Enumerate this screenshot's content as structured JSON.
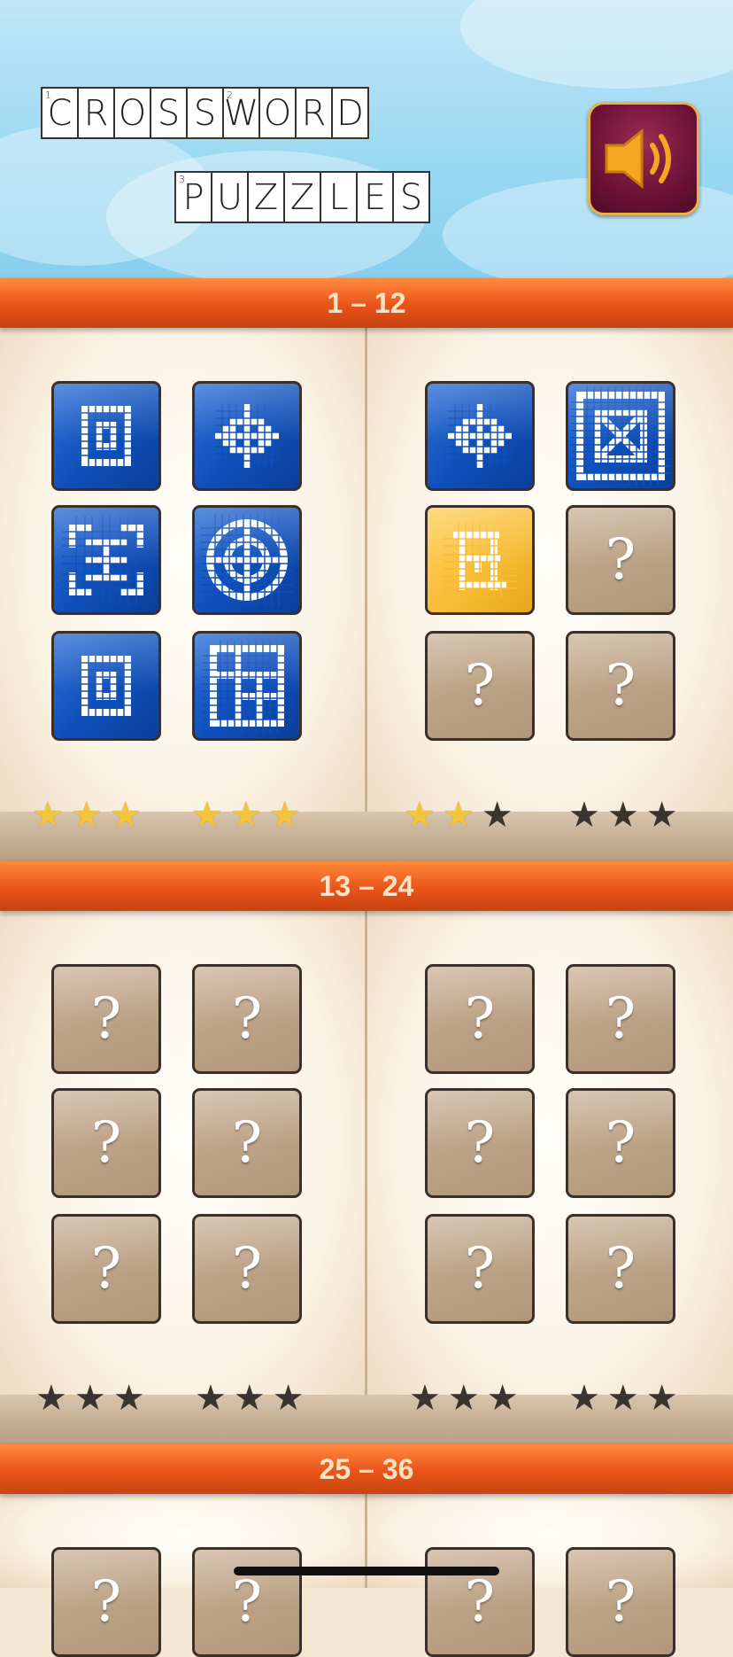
{
  "header": {
    "title_line1": [
      "C",
      "R",
      "O",
      "S",
      "S",
      "W",
      "O",
      "R",
      "D"
    ],
    "title_line1_clue_numbers": {
      "0": "1",
      "5": "2"
    },
    "title_line2": [
      "P",
      "U",
      "Z",
      "Z",
      "L",
      "E",
      "S"
    ],
    "title_line2_clue_numbers": {
      "0": "3"
    },
    "sound_icon": "speaker-icon"
  },
  "sections": [
    {
      "label": "1 – 12"
    },
    {
      "label": "13 – 24"
    },
    {
      "label": "25 – 36"
    }
  ],
  "levels_1_12": {
    "left_page_stars": [
      3,
      3
    ],
    "right_page_stars": [
      2,
      0
    ]
  },
  "levels_13_24": {
    "left_page_stars": [
      0,
      0
    ],
    "right_page_stars": [
      0,
      0
    ]
  },
  "locked_symbol": "?",
  "colors": {
    "band": "#e8541a",
    "solved_tile": "#0f4fb9",
    "current_tile": "#f7bb33",
    "locked_tile": "#bca286",
    "star_on": "#f3c53a",
    "star_off": "#3a3431"
  }
}
